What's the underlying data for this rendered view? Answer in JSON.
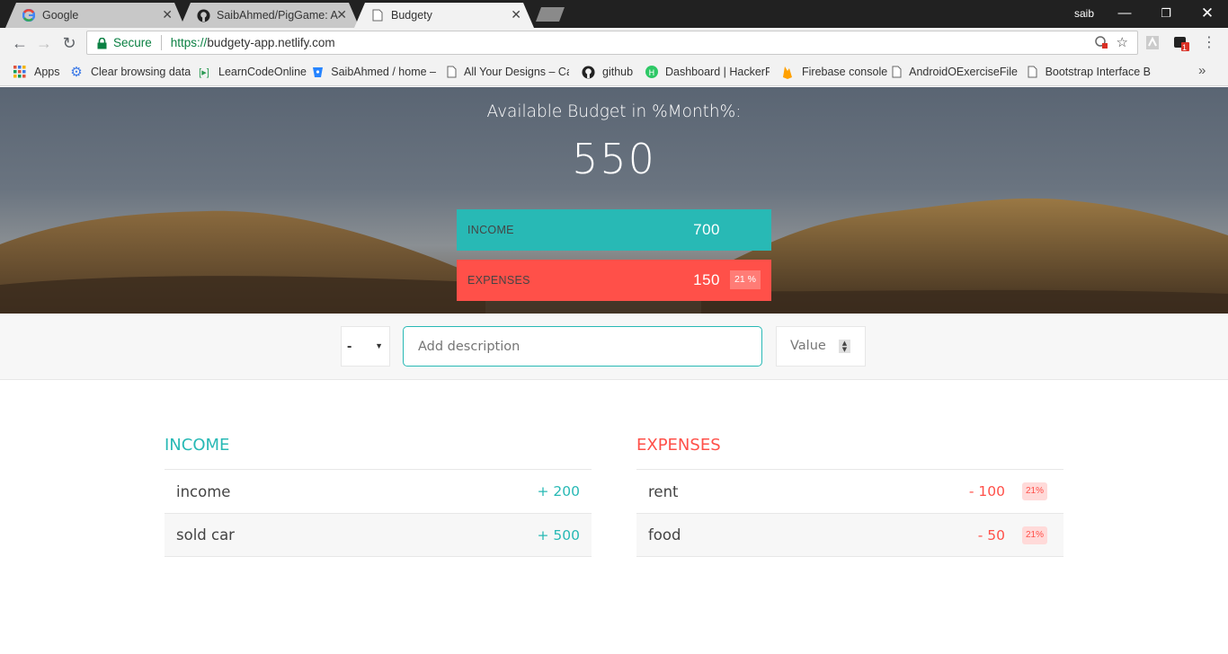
{
  "browser": {
    "tabs": [
      {
        "title": "Google",
        "icon": "google-g-icon"
      },
      {
        "title": "SaibAhmed/PigGame: A g",
        "icon": "github-icon"
      },
      {
        "title": "Budgety",
        "icon": "page-icon"
      }
    ],
    "user": "saib",
    "secure_label": "Secure",
    "url_scheme": "https://",
    "url_host": "budgety-app.netlify.com",
    "extension_badge": "1",
    "bookmarks": [
      {
        "label": "Apps",
        "icon": "apps-grid-icon"
      },
      {
        "label": "Clear browsing data",
        "icon": "gear-icon"
      },
      {
        "label": "LearnCodeOnline",
        "icon": "play-icon"
      },
      {
        "label": "SaibAhmed / home –",
        "icon": "bitbucket-icon"
      },
      {
        "label": "All Your Designs – Ca",
        "icon": "page-icon"
      },
      {
        "label": "github",
        "icon": "github-icon"
      },
      {
        "label": "Dashboard | HackerR",
        "icon": "hackerrank-icon"
      },
      {
        "label": "Firebase console",
        "icon": "firebase-icon"
      },
      {
        "label": "AndroidOExerciseFile",
        "icon": "page-icon"
      },
      {
        "label": "Bootstrap Interface B",
        "icon": "page-icon"
      }
    ],
    "more_label": "»"
  },
  "app": {
    "budget_title": "Available Budget in %Month%:",
    "budget_value": "550",
    "income_label": "INCOME",
    "income_value": "700",
    "expenses_label": "EXPENSES",
    "expenses_value": "150",
    "expenses_percentage": "21 %",
    "add": {
      "type_value": "-",
      "description_placeholder": "Add description",
      "value_placeholder": "Value"
    },
    "income_title": "INCOME",
    "expenses_title": "EXPENSES",
    "income_items": [
      {
        "description": "income",
        "value": "+ 200"
      },
      {
        "description": "sold car",
        "value": "+ 500"
      }
    ],
    "expense_items": [
      {
        "description": "rent",
        "value": "- 100",
        "percentage": "21%"
      },
      {
        "description": "food",
        "value": "- 50",
        "percentage": "21%"
      }
    ],
    "colors": {
      "income": "#28b9b5",
      "expenses": "#ff5049"
    }
  }
}
